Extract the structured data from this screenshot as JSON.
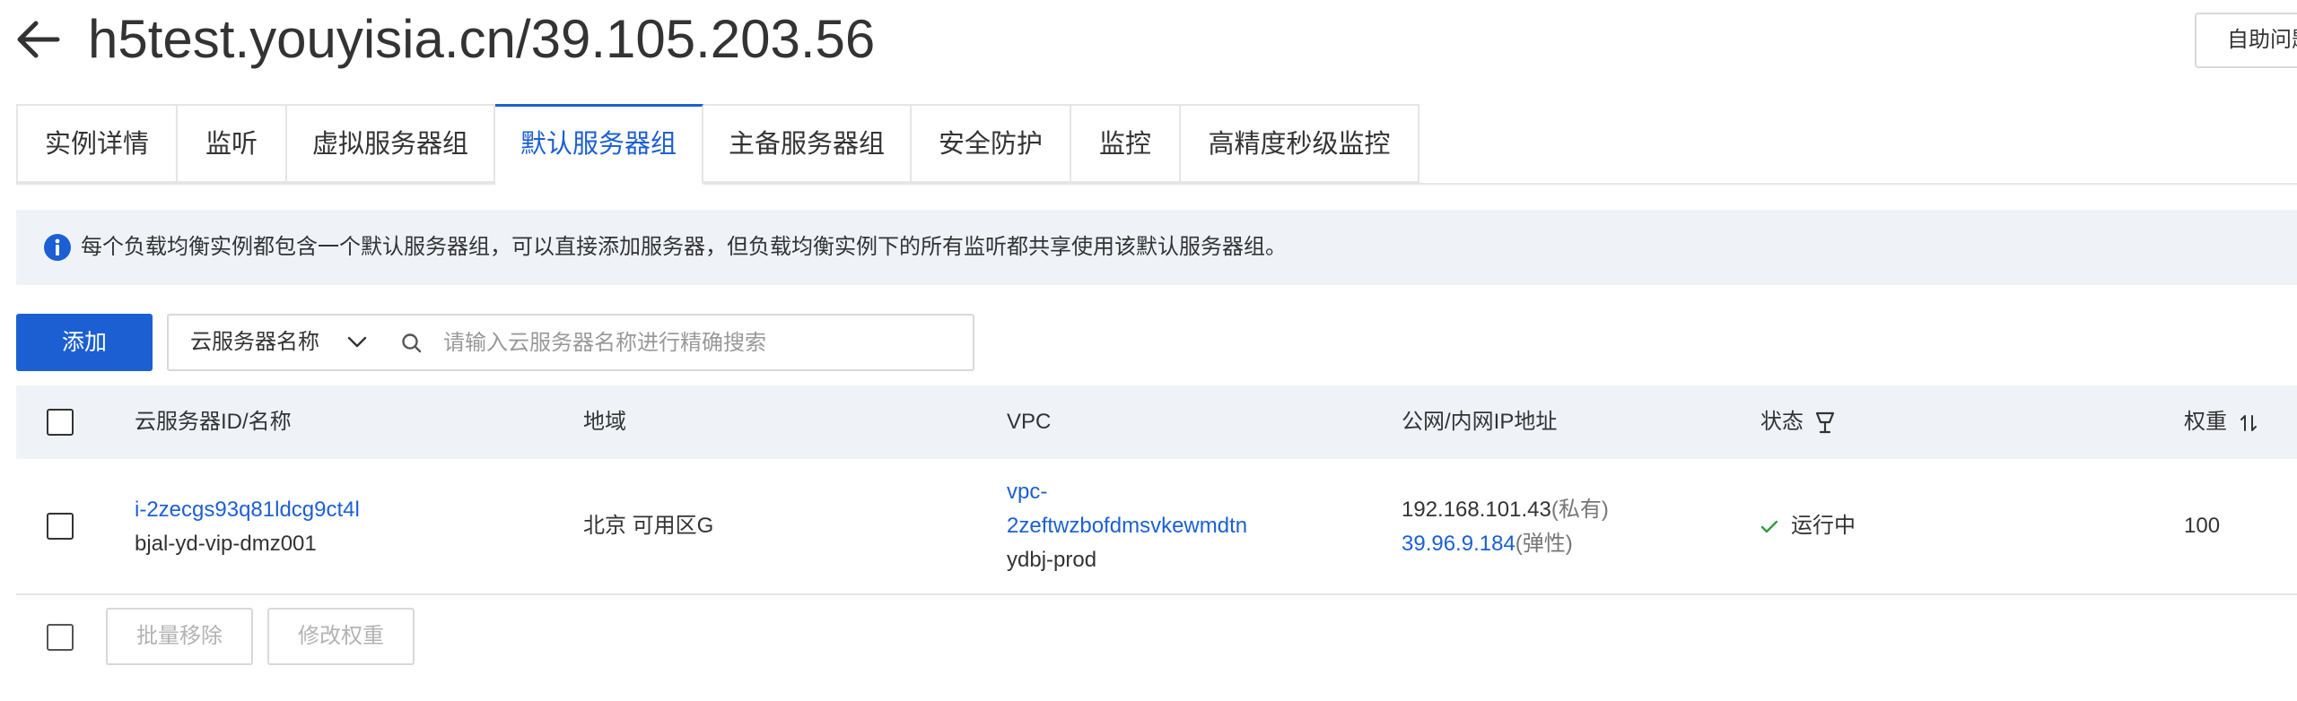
{
  "header": {
    "title": "h5test.youyisia.cn/39.105.203.56",
    "help_button": "自助问题"
  },
  "tabs": [
    {
      "label": "实例详情",
      "active": false
    },
    {
      "label": "监听",
      "active": false
    },
    {
      "label": "虚拟服务器组",
      "active": false
    },
    {
      "label": "默认服务器组",
      "active": true
    },
    {
      "label": "主备服务器组",
      "active": false
    },
    {
      "label": "安全防护",
      "active": false
    },
    {
      "label": "监控",
      "active": false
    },
    {
      "label": "高精度秒级监控",
      "active": false
    }
  ],
  "notice": {
    "text": "每个负载均衡实例都包含一个默认服务器组，可以直接添加服务器，但负载均衡实例下的所有监听都共享使用该默认服务器组。"
  },
  "toolbar": {
    "add_label": "添加",
    "filter_selected": "云服务器名称",
    "search_placeholder": "请输入云服务器名称进行精确搜索"
  },
  "table": {
    "columns": {
      "name": "云服务器ID/名称",
      "region": "地域",
      "vpc": "VPC",
      "ip": "公网/内网IP地址",
      "status": "状态",
      "weight": "权重"
    },
    "rows": [
      {
        "id": "i-2zecgs93q81ldcg9ct4l",
        "name": "bjal-yd-vip-dmz001",
        "region": "北京 可用区G",
        "vpc_id_line1": "vpc-",
        "vpc_id_line2": "2zeftwzbofdmsvkewmdtn",
        "vpc_name": "ydbj-prod",
        "private_ip": "192.168.101.43",
        "private_tag": "(私有)",
        "public_ip": "39.96.9.184",
        "public_tag": "(弹性)",
        "status": "运行中",
        "weight": "100"
      }
    ]
  },
  "bulk_actions": {
    "remove_label": "批量移除",
    "weight_label": "修改权重"
  },
  "colors": {
    "accent": "#1c5fd3",
    "notice_bg": "#eff3f8",
    "status_ok": "#2e9e3f"
  }
}
